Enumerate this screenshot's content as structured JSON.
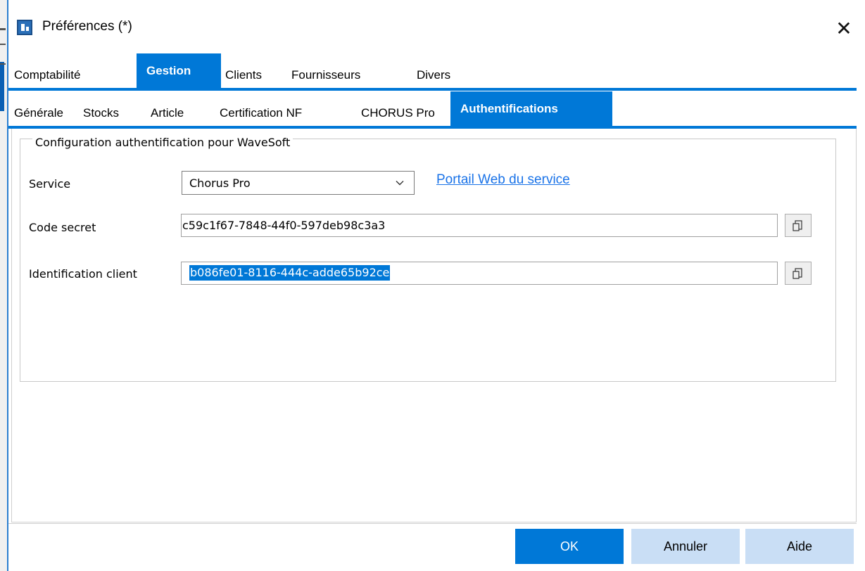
{
  "window": {
    "title": "Préférences (*)",
    "close_glyph": "✕"
  },
  "main_tabs": [
    {
      "label": "Comptabilité",
      "active": false
    },
    {
      "label": "Gestion",
      "active": true
    },
    {
      "label": "Clients",
      "active": false
    },
    {
      "label": "Fournisseurs",
      "active": false
    },
    {
      "label": "Divers",
      "active": false
    }
  ],
  "sub_tabs": [
    {
      "label": "Générale",
      "active": false
    },
    {
      "label": "Stocks",
      "active": false
    },
    {
      "label": "Article",
      "active": false
    },
    {
      "label": "Certification NF",
      "active": false
    },
    {
      "label": "CHORUS Pro",
      "active": false
    },
    {
      "label": "Authentifications",
      "active": true
    }
  ],
  "group": {
    "title": "Configuration authentification pour WaveSoft"
  },
  "form": {
    "service_label": "Service",
    "service_value": "Chorus Pro",
    "portal_link": "Portail Web du service",
    "secret_label": "Code secret",
    "secret_value": "c59c1f67-7848-44f0-597deb98c3a3",
    "client_label": "Identification client",
    "client_value": "b086fe01-8116-444c-adde65b92ce"
  },
  "buttons": {
    "ok": "OK",
    "cancel": "Annuler",
    "help": "Aide"
  },
  "colors": {
    "accent": "#0078d7",
    "secondary_button": "#c9def5",
    "link": "#1a73e8"
  }
}
